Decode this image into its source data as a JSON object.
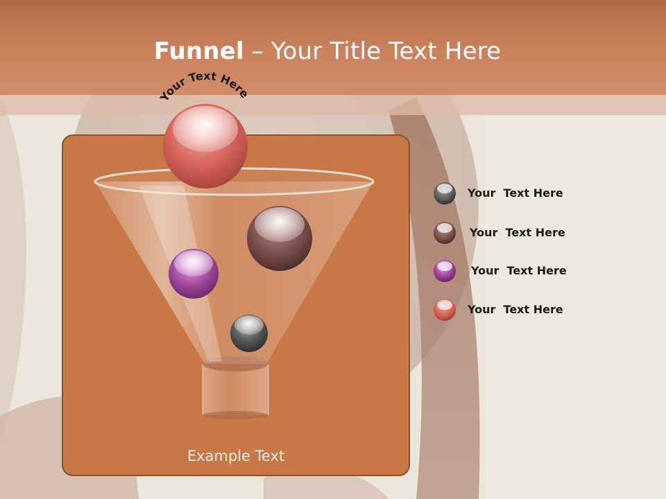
{
  "slide": {
    "title_bold": "Funnel",
    "title_rest": " – Your Title Text Here",
    "arc_label": "Your Text Here",
    "panel_caption": "Example Text"
  },
  "legend": [
    {
      "label": "Your  Text Here",
      "color": "#5c5c5c"
    },
    {
      "label": "Your  Text Here",
      "color": "#7a4e4e"
    },
    {
      "label": "Your  Text Here",
      "color": "#9a3f9a"
    },
    {
      "label": "Your  Text Here",
      "color": "#d4604f"
    }
  ],
  "balls": [
    {
      "name": "top",
      "color": "#d5615a"
    },
    {
      "name": "large",
      "color": "#7c4f4f"
    },
    {
      "name": "purple",
      "color": "#a0479e"
    },
    {
      "name": "small",
      "color": "#555555"
    }
  ],
  "colors": {
    "header": "#c77b55",
    "panel": "#c87746",
    "panel_border": "#8a5236",
    "title_text": "#ffffff"
  }
}
